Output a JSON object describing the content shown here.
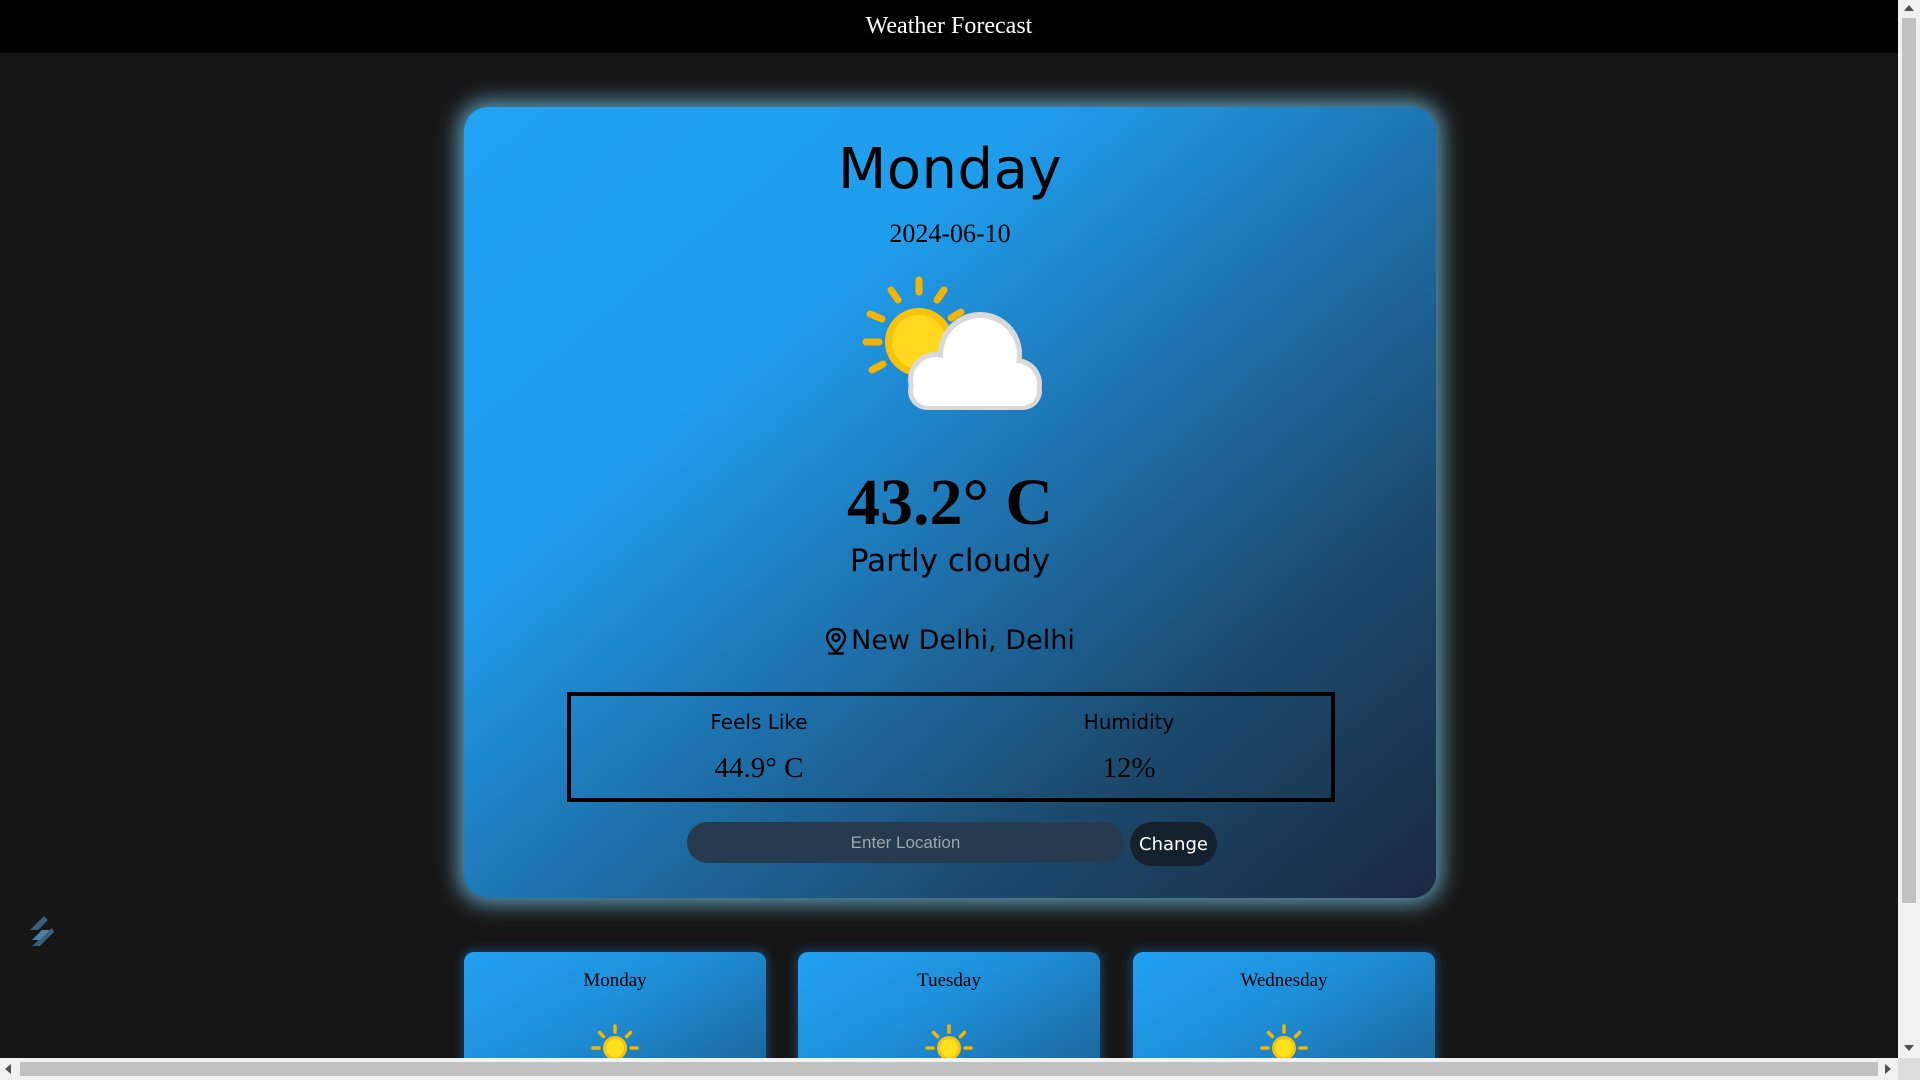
{
  "header": {
    "title": "Weather Forecast"
  },
  "current": {
    "day": "Monday",
    "date": "2024-06-10",
    "icon": "partly-cloudy-icon",
    "temperature": "43.2° C",
    "condition": "Partly cloudy",
    "location": "New Delhi, Delhi",
    "feels_like_label": "Feels Like",
    "feels_like_value": "44.9° C",
    "humidity_label": "Humidity",
    "humidity_value": "12%"
  },
  "search": {
    "placeholder": "Enter Location",
    "button_label": "Change"
  },
  "forecast": [
    {
      "day": "Monday",
      "icon": "sun-icon"
    },
    {
      "day": "Tuesday",
      "icon": "sun-icon"
    },
    {
      "day": "Wednesday",
      "icon": "sun-icon"
    }
  ],
  "colors": {
    "page_background": "#161616",
    "header_background": "#000000",
    "card_gradient_start": "#22a2f2",
    "card_gradient_end": "#1a2a40",
    "card_glow": "#78c8eb",
    "button_background": "#14202c"
  }
}
